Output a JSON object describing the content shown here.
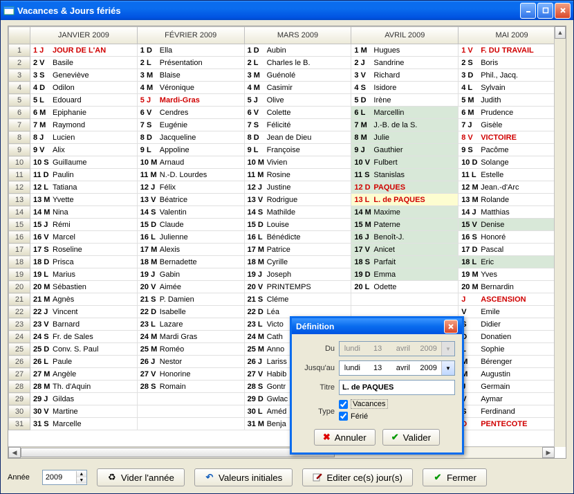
{
  "window": {
    "title": "Vacances & Jours fériés"
  },
  "months": [
    "JANVIER 2009",
    "FÉVRIER 2009",
    "MARS 2009",
    "AVRIL 2009",
    "MAI 2009"
  ],
  "rows": 31,
  "cells": {
    "jan": [
      {
        "d": "1 J",
        "n": "JOUR DE L'AN",
        "flags": "red"
      },
      {
        "d": "2 V",
        "n": "Basile"
      },
      {
        "d": "3 S",
        "n": "Geneviève"
      },
      {
        "d": "4 D",
        "n": "Odilon"
      },
      {
        "d": "5 L",
        "n": "Edouard"
      },
      {
        "d": "6 M",
        "n": "Epiphanie"
      },
      {
        "d": "7 M",
        "n": "Raymond"
      },
      {
        "d": "8 J",
        "n": "Lucien"
      },
      {
        "d": "9 V",
        "n": "Alix"
      },
      {
        "d": "10 S",
        "n": "Guillaume"
      },
      {
        "d": "11 D",
        "n": "Paulin"
      },
      {
        "d": "12 L",
        "n": "Tatiana"
      },
      {
        "d": "13 M",
        "n": "Yvette"
      },
      {
        "d": "14 M",
        "n": "Nina"
      },
      {
        "d": "15 J",
        "n": "Rémi"
      },
      {
        "d": "16 V",
        "n": "Marcel"
      },
      {
        "d": "17 S",
        "n": "Roseline"
      },
      {
        "d": "18 D",
        "n": "Prisca"
      },
      {
        "d": "19 L",
        "n": "Marius"
      },
      {
        "d": "20 M",
        "n": "Sébastien"
      },
      {
        "d": "21 M",
        "n": "Agnès"
      },
      {
        "d": "22 J",
        "n": "Vincent"
      },
      {
        "d": "23 V",
        "n": "Barnard"
      },
      {
        "d": "24 S",
        "n": "Fr. de Sales"
      },
      {
        "d": "25 D",
        "n": "Conv. S. Paul"
      },
      {
        "d": "26 L",
        "n": "Paule"
      },
      {
        "d": "27 M",
        "n": "Angèle"
      },
      {
        "d": "28 M",
        "n": "Th. d'Aquin"
      },
      {
        "d": "29 J",
        "n": "Gildas"
      },
      {
        "d": "30 V",
        "n": "Martine"
      },
      {
        "d": "31 S",
        "n": "Marcelle"
      }
    ],
    "feb": [
      {
        "d": "1 D",
        "n": "Ella"
      },
      {
        "d": "2 L",
        "n": "Présentation"
      },
      {
        "d": "3 M",
        "n": "Blaise"
      },
      {
        "d": "4 M",
        "n": "Véronique"
      },
      {
        "d": "5 J",
        "n": "Mardi-Gras",
        "flags": "red"
      },
      {
        "d": "6 V",
        "n": "Cendres"
      },
      {
        "d": "7 S",
        "n": "Eugénie"
      },
      {
        "d": "8 D",
        "n": "Jacqueline"
      },
      {
        "d": "9 L",
        "n": "Appoline"
      },
      {
        "d": "10 M",
        "n": "Arnaud"
      },
      {
        "d": "11 M",
        "n": "N.-D. Lourdes"
      },
      {
        "d": "12 J",
        "n": "Félix"
      },
      {
        "d": "13 V",
        "n": "Béatrice"
      },
      {
        "d": "14 S",
        "n": "Valentin"
      },
      {
        "d": "15 D",
        "n": "Claude"
      },
      {
        "d": "16 L",
        "n": "Julienne"
      },
      {
        "d": "17 M",
        "n": "Alexis"
      },
      {
        "d": "18 M",
        "n": "Bernadette"
      },
      {
        "d": "19 J",
        "n": "Gabin"
      },
      {
        "d": "20 V",
        "n": "Aimée"
      },
      {
        "d": "21 S",
        "n": "P. Damien"
      },
      {
        "d": "22 D",
        "n": "Isabelle"
      },
      {
        "d": "23 L",
        "n": "Lazare"
      },
      {
        "d": "24 M",
        "n": "Mardi Gras"
      },
      {
        "d": "25 M",
        "n": "Roméo"
      },
      {
        "d": "26 J",
        "n": "Nestor"
      },
      {
        "d": "27 V",
        "n": "Honorine"
      },
      {
        "d": "28 S",
        "n": "Romain"
      },
      {
        "d": "",
        "n": ""
      },
      {
        "d": "",
        "n": ""
      },
      {
        "d": "",
        "n": ""
      }
    ],
    "mar": [
      {
        "d": "1 D",
        "n": "Aubin"
      },
      {
        "d": "2 L",
        "n": "Charles le B."
      },
      {
        "d": "3 M",
        "n": "Guénolé"
      },
      {
        "d": "4 M",
        "n": "Casimir"
      },
      {
        "d": "5 J",
        "n": "Olive"
      },
      {
        "d": "6 V",
        "n": "Colette"
      },
      {
        "d": "7 S",
        "n": "Félicité"
      },
      {
        "d": "8 D",
        "n": "Jean de Dieu"
      },
      {
        "d": "9 L",
        "n": "Françoise"
      },
      {
        "d": "10 M",
        "n": "Vivien"
      },
      {
        "d": "11 M",
        "n": "Rosine"
      },
      {
        "d": "12 J",
        "n": "Justine"
      },
      {
        "d": "13 V",
        "n": "Rodrigue"
      },
      {
        "d": "14 S",
        "n": "Mathilde"
      },
      {
        "d": "15 D",
        "n": "Louise"
      },
      {
        "d": "16 L",
        "n": "Bénédicte"
      },
      {
        "d": "17 M",
        "n": "Patrice"
      },
      {
        "d": "18 M",
        "n": "Cyrille"
      },
      {
        "d": "19 J",
        "n": "Joseph"
      },
      {
        "d": "20 V",
        "n": "PRINTEMPS"
      },
      {
        "d": "21 S",
        "n": "Cléme"
      },
      {
        "d": "22 D",
        "n": "Léa"
      },
      {
        "d": "23 L",
        "n": "Victo"
      },
      {
        "d": "24 M",
        "n": "Cath"
      },
      {
        "d": "25 M",
        "n": "Anno"
      },
      {
        "d": "26 J",
        "n": "Lariss"
      },
      {
        "d": "27 V",
        "n": "Habib"
      },
      {
        "d": "28 S",
        "n": "Gontr"
      },
      {
        "d": "29 D",
        "n": "Gwlac"
      },
      {
        "d": "30 L",
        "n": "Améd"
      },
      {
        "d": "31 M",
        "n": "Benja"
      }
    ],
    "apr": [
      {
        "d": "1 M",
        "n": "Hugues"
      },
      {
        "d": "2 J",
        "n": "Sandrine"
      },
      {
        "d": "3 V",
        "n": "Richard"
      },
      {
        "d": "4 S",
        "n": "Isidore"
      },
      {
        "d": "5 D",
        "n": "Irène"
      },
      {
        "d": "6 L",
        "n": "Marcellin",
        "bg": "green"
      },
      {
        "d": "7 M",
        "n": "J.-B. de la S.",
        "bg": "green"
      },
      {
        "d": "8 M",
        "n": "Julie",
        "bg": "green"
      },
      {
        "d": "9 J",
        "n": "Gauthier",
        "bg": "green"
      },
      {
        "d": "10 V",
        "n": "Fulbert",
        "bg": "green"
      },
      {
        "d": "11 S",
        "n": "Stanislas",
        "bg": "green"
      },
      {
        "d": "12 D",
        "n": "PAQUES",
        "flags": "red",
        "bg": "green"
      },
      {
        "d": "13 L",
        "n": "L. de PAQUES",
        "flags": "red",
        "bg": "yellow"
      },
      {
        "d": "14 M",
        "n": "Maxime",
        "bg": "green"
      },
      {
        "d": "15 M",
        "n": "Paterne",
        "bg": "green"
      },
      {
        "d": "16 J",
        "n": "Benoît-J.",
        "bg": "green"
      },
      {
        "d": "17 V",
        "n": "Anicet",
        "bg": "green"
      },
      {
        "d": "18 S",
        "n": "Parfait",
        "bg": "green"
      },
      {
        "d": "19 D",
        "n": "Emma",
        "bg": "green"
      },
      {
        "d": "20 L",
        "n": "Odette"
      },
      {
        "d": "",
        "n": ""
      },
      {
        "d": "",
        "n": ""
      },
      {
        "d": "",
        "n": ""
      },
      {
        "d": "",
        "n": ""
      },
      {
        "d": "",
        "n": ""
      },
      {
        "d": "",
        "n": ""
      },
      {
        "d": "",
        "n": ""
      },
      {
        "d": "",
        "n": ""
      },
      {
        "d": "",
        "n": ""
      },
      {
        "d": "",
        "n": ""
      },
      {
        "d": "",
        "n": ""
      }
    ],
    "may": [
      {
        "d": "1 V",
        "n": "F. DU TRAVAIL",
        "flags": "red"
      },
      {
        "d": "2 S",
        "n": "Boris"
      },
      {
        "d": "3 D",
        "n": "Phil., Jacq."
      },
      {
        "d": "4 L",
        "n": "Sylvain"
      },
      {
        "d": "5 M",
        "n": "Judith"
      },
      {
        "d": "6 M",
        "n": "Prudence"
      },
      {
        "d": "7 J",
        "n": "Gisèle"
      },
      {
        "d": "8 V",
        "n": "VICTOIRE",
        "flags": "red"
      },
      {
        "d": "9 S",
        "n": "Pacôme"
      },
      {
        "d": "10 D",
        "n": "Solange"
      },
      {
        "d": "11 L",
        "n": "Estelle"
      },
      {
        "d": "12 M",
        "n": "Jean.-d'Arc"
      },
      {
        "d": "13 M",
        "n": "Rolande"
      },
      {
        "d": "14 J",
        "n": "Matthias"
      },
      {
        "d": "15 V",
        "n": "Denise",
        "bg": "green"
      },
      {
        "d": "16 S",
        "n": "Honoré"
      },
      {
        "d": "17 D",
        "n": "Pascal"
      },
      {
        "d": "18 L",
        "n": "Eric",
        "bg": "green"
      },
      {
        "d": "19 M",
        "n": "Yves"
      },
      {
        "d": "20 M",
        "n": "Bernardin"
      },
      {
        "d": "J",
        "n": "ASCENSION",
        "flags": "red"
      },
      {
        "d": "V",
        "n": "Emile"
      },
      {
        "d": "S",
        "n": "Didier"
      },
      {
        "d": "D",
        "n": "Donatien"
      },
      {
        "d": "L",
        "n": "Sophie"
      },
      {
        "d": "M",
        "n": "Bérenger"
      },
      {
        "d": "M",
        "n": "Augustin"
      },
      {
        "d": "J",
        "n": "Germain"
      },
      {
        "d": "V",
        "n": "Aymar"
      },
      {
        "d": "S",
        "n": "Ferdinand"
      },
      {
        "d": "D",
        "n": "PENTECOTE",
        "flags": "red"
      }
    ]
  },
  "footer": {
    "year_label": "Année",
    "year_value": "2009",
    "clear_year": "Vider l'année",
    "defaults": "Valeurs initiales",
    "edit_days": "Editer ce(s) jour(s)",
    "close": "Fermer"
  },
  "dialog": {
    "title": "Définition",
    "from_label": "Du",
    "to_label": "Jusqu'au",
    "date_from": {
      "dow": "lundi",
      "day": "13",
      "month": "avril",
      "year": "2009"
    },
    "date_to": {
      "dow": "lundi",
      "day": "13",
      "month": "avril",
      "year": "2009"
    },
    "title_label": "Titre",
    "title_value": "L. de PAQUES",
    "type_label": "Type",
    "type_vacances": "Vacances",
    "type_ferie": "Férié",
    "cancel": "Annuler",
    "ok": "Valider"
  }
}
